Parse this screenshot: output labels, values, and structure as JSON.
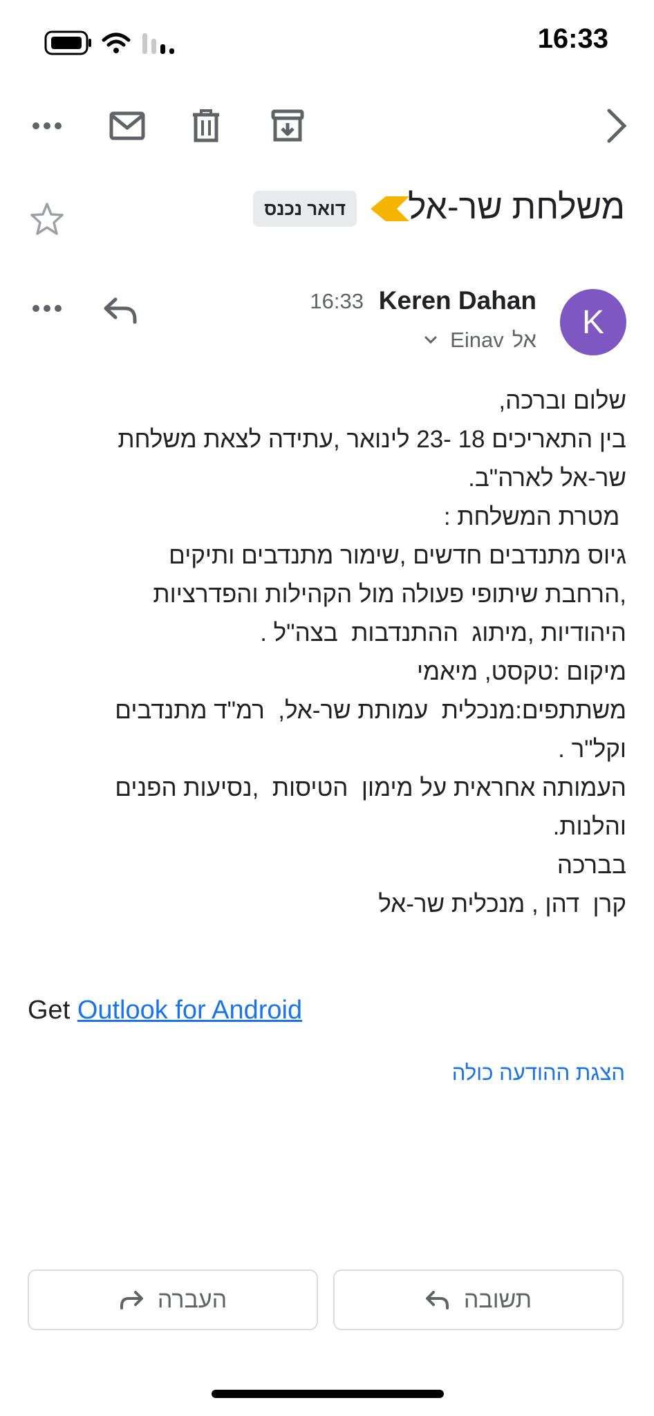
{
  "status_bar": {
    "time": "16:33"
  },
  "toolbar": {
    "more_icon": "more-horizontal-icon",
    "mark_unread_icon": "mail-icon",
    "delete_icon": "trash-icon",
    "archive_icon": "archive-icon",
    "back_icon": "chevron-right-icon"
  },
  "email": {
    "subject": "משלחת שר-אל",
    "label": "דואר נכנס",
    "star_icon": "star-outline-icon",
    "sender": {
      "initial": "K",
      "name": "Keren Dahan",
      "time": "16:33",
      "recipient_prefix": "אל",
      "recipient": "Einav",
      "avatar_color": "#7e57c2"
    },
    "body_lines": [
      "שלום וברכה,",
      "בין התאריכים 18 -23 לינואר ,עתידה לצאת משלחת",
      "שר-אל לארה\"ב.",
      " מטרת המשלחת :",
      "גיוס מתנדבים חדשים ,שימור מתנדבים ותיקים",
      ",הרחבת שיתופי פעולה מול הקהילות והפדרציות",
      "היהודיות ,מיתוג  ההתנדבות  בצה\"ל .",
      "מיקום :טקסט, מיאמי",
      "משתתפים:מנכלית  עמותת שר-אל,  רמ\"ד מתנדבים",
      "וקל\"ר .",
      "העמותה אחראית על מימון  הטיסות  ,נסיעות הפנים",
      "והלנות.",
      "בברכה",
      "קרן  דהן , מנכלית שר-אל"
    ],
    "signature_prefix": "Get",
    "signature_link": "Outlook for Android",
    "show_full_message": "הצגת ההודעה כולה"
  },
  "actions": {
    "forward_label": "העברה",
    "reply_label": "תשובה"
  },
  "colors": {
    "accent": "#1a73e8",
    "important": "#f4b400"
  }
}
